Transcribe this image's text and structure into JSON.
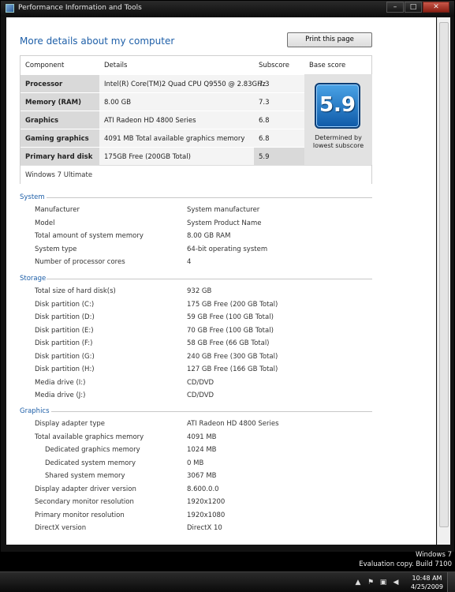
{
  "window": {
    "title": "Performance Information and Tools",
    "minimize": "–",
    "maximize": "□",
    "close": "✕"
  },
  "page": {
    "heading": "More details about my computer",
    "print_label": "Print this page"
  },
  "score": {
    "headers": {
      "component": "Component",
      "details": "Details",
      "subscore": "Subscore",
      "base": "Base score"
    },
    "rows": [
      {
        "component": "Processor",
        "details": "Intel(R) Core(TM)2 Quad CPU Q9550 @ 2.83GHz",
        "subscore": "7.3"
      },
      {
        "component": "Memory (RAM)",
        "details": "8.00 GB",
        "subscore": "7.3"
      },
      {
        "component": "Graphics",
        "details": "ATI Radeon HD 4800 Series",
        "subscore": "6.8"
      },
      {
        "component": "Gaming graphics",
        "details": "4091 MB Total available graphics memory",
        "subscore": "6.8"
      },
      {
        "component": "Primary hard disk",
        "details": "175GB Free (200GB Total)",
        "subscore": "5.9"
      }
    ],
    "base_score": "5.9",
    "base_note": "Determined by lowest subscore",
    "edition": "Windows 7 Ultimate"
  },
  "system": {
    "title": "System",
    "items": [
      {
        "k": "Manufacturer",
        "v": "System manufacturer"
      },
      {
        "k": "Model",
        "v": "System Product Name"
      },
      {
        "k": "Total amount of system memory",
        "v": "8.00 GB RAM"
      },
      {
        "k": "System type",
        "v": "64-bit operating system"
      },
      {
        "k": "Number of processor cores",
        "v": "4"
      }
    ]
  },
  "storage": {
    "title": "Storage",
    "items": [
      {
        "k": "Total size of hard disk(s)",
        "v": "932 GB"
      },
      {
        "k": "Disk partition (C:)",
        "v": "175 GB Free (200 GB Total)"
      },
      {
        "k": "Disk partition (D:)",
        "v": "59 GB Free (100 GB Total)"
      },
      {
        "k": "Disk partition (E:)",
        "v": "70 GB Free (100 GB Total)"
      },
      {
        "k": "Disk partition (F:)",
        "v": "58 GB Free (66 GB Total)"
      },
      {
        "k": "Disk partition (G:)",
        "v": "240 GB Free (300 GB Total)"
      },
      {
        "k": "Disk partition (H:)",
        "v": "127 GB Free (166 GB Total)"
      },
      {
        "k": "Media drive (I:)",
        "v": "CD/DVD"
      },
      {
        "k": "Media drive (J:)",
        "v": "CD/DVD"
      }
    ]
  },
  "graphics": {
    "title": "Graphics",
    "items": [
      {
        "k": "Display adapter type",
        "v": "ATI Radeon HD 4800 Series"
      },
      {
        "k": "Total available graphics memory",
        "v": "4091 MB"
      },
      {
        "k": "Dedicated graphics memory",
        "v": "1024 MB"
      },
      {
        "k": "Dedicated system memory",
        "v": "0 MB"
      },
      {
        "k": "Shared system memory",
        "v": "3067 MB"
      },
      {
        "k": "Display adapter driver version",
        "v": "8.600.0.0"
      },
      {
        "k": "Secondary monitor resolution",
        "v": "1920x1200"
      },
      {
        "k": "Primary monitor resolution",
        "v": "1920x1080"
      },
      {
        "k": "DirectX version",
        "v": "DirectX 10"
      }
    ]
  },
  "watermark": {
    "line1": "Windows 7",
    "line2": "Evaluation copy. Build 7100"
  },
  "taskbar": {
    "time": "10:48 AM",
    "date": "4/25/2009"
  },
  "icons": {
    "app": "performance-icon",
    "flag": "action-center-icon",
    "network": "network-icon",
    "volume": "volume-icon",
    "tray_up": "show-hidden-icons-icon"
  }
}
